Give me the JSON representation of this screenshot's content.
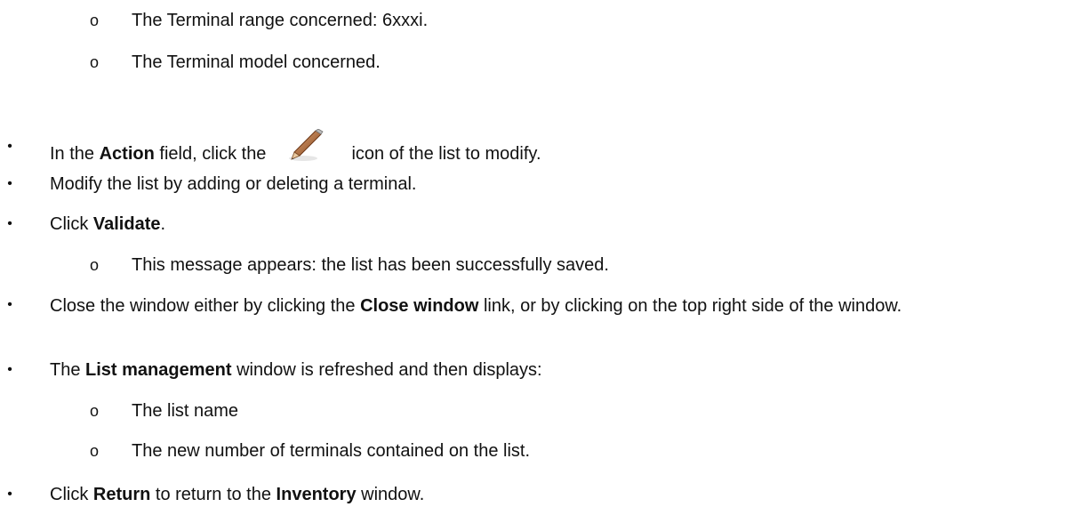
{
  "top_items": [
    {
      "bullet": "o",
      "text": "The Terminal range concerned: 6xxxi."
    },
    {
      "bullet": "o",
      "text": "The Terminal model concerned."
    }
  ],
  "steps": {
    "action": {
      "bullet": "•",
      "before": "In the ",
      "bold": "Action",
      "middle": " field, click the",
      "after": "icon of the list to modify.",
      "icon": "pencil-icon"
    },
    "modify": {
      "bullet": "•",
      "text": "Modify the list by adding or deleting a terminal."
    },
    "validate": {
      "bullet": "•",
      "before": "Click ",
      "bold": "Validate",
      "after": "."
    },
    "validate_sub": {
      "bullet": "o",
      "text": "This message appears: the list has been successfully saved."
    },
    "close": {
      "bullet": "•",
      "before": "Close the window either by clicking the ",
      "bold": "Close window",
      "after": " link, or by clicking  on the top right side of the window."
    },
    "list_mgmt": {
      "bullet": "•",
      "before": "The ",
      "bold": "List management",
      "after": " window is refreshed and then displays:"
    },
    "list_mgmt_sub": [
      {
        "bullet": "o",
        "text": "The list name"
      },
      {
        "bullet": "o",
        "text": "The new number of terminals contained on the list."
      }
    ],
    "return": {
      "bullet": "•",
      "before": "Click ",
      "bold": "Return",
      "middle": " to return to the ",
      "bold2": "Inventory",
      "after": " window."
    }
  }
}
